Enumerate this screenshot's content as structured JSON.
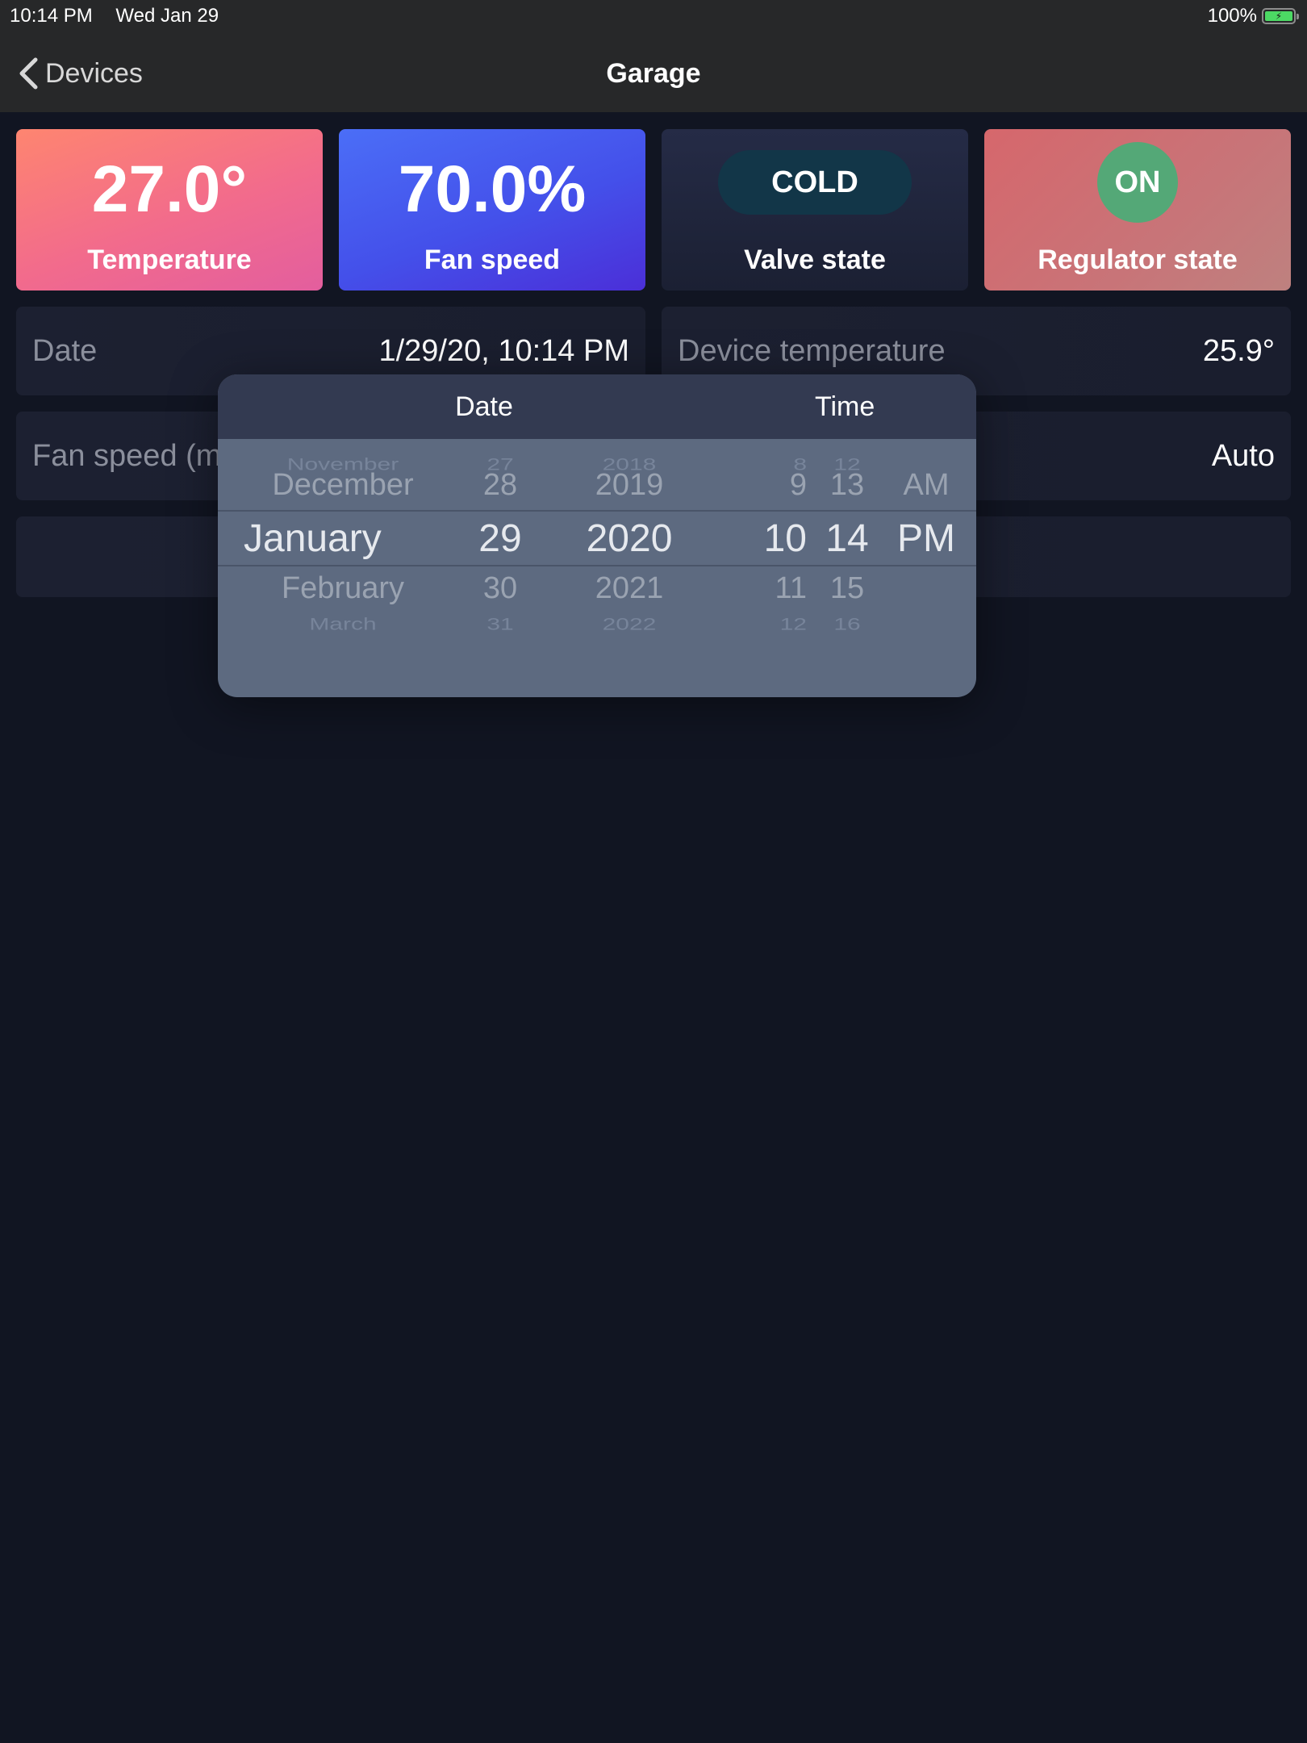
{
  "status_bar": {
    "time": "10:14 PM",
    "date": "Wed Jan 29",
    "battery": "100%"
  },
  "nav": {
    "back_label": "Devices",
    "title": "Garage"
  },
  "cards": {
    "temperature": {
      "value": "27.0°",
      "label": "Temperature"
    },
    "fan_speed": {
      "value": "70.0%",
      "label": "Fan speed"
    },
    "valve_state": {
      "value": "COLD",
      "label": "Valve state"
    },
    "regulator_state": {
      "value": "ON",
      "label": "Regulator state"
    }
  },
  "rows": {
    "date": {
      "label": "Date",
      "value": "1/29/20, 10:14 PM"
    },
    "device_temperature": {
      "label": "Device temperature",
      "value": "25.9°"
    },
    "fan_speed_mode": {
      "label": "Fan speed (m",
      "value": "Auto"
    }
  },
  "picker": {
    "header_date": "Date",
    "header_time": "Time",
    "month": [
      "November",
      "December",
      "January",
      "February",
      "March"
    ],
    "day": [
      "27",
      "28",
      "29",
      "30",
      "31"
    ],
    "year": [
      "2018",
      "2019",
      "2020",
      "2021",
      "2022"
    ],
    "hour": [
      "8",
      "9",
      "10",
      "11",
      "12"
    ],
    "minute": [
      "12",
      "13",
      "14",
      "15",
      "16"
    ],
    "ampm": [
      "",
      "AM",
      "PM",
      "",
      ""
    ]
  },
  "colors": {
    "background": "#111522",
    "topbar": "#272829",
    "temperature_card": "#f26b8c",
    "fan_card": "#4450ea",
    "valve_card": "#20253b",
    "regulator_card": "#c87478",
    "valve_pill": "#123648",
    "regulator_circle": "#54a877",
    "battery": "#4cd964"
  }
}
